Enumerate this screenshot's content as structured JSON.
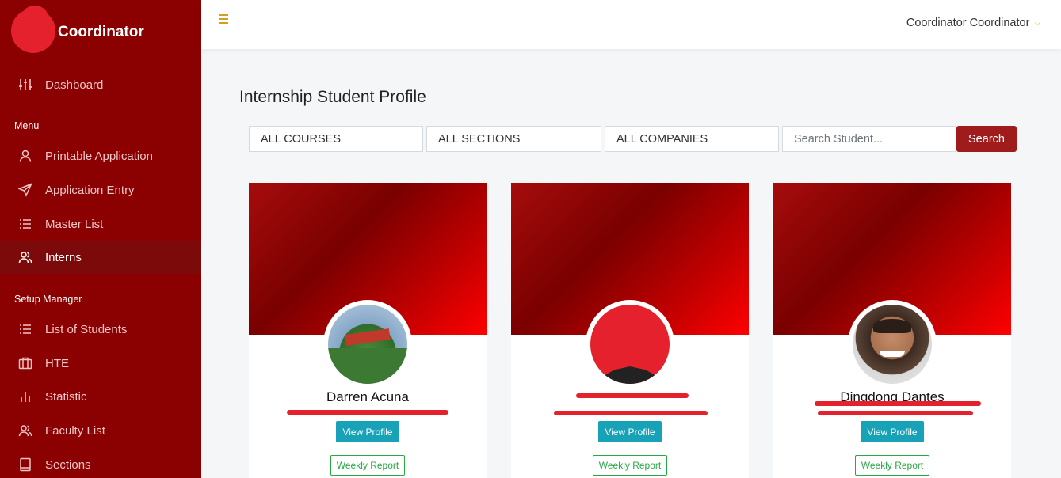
{
  "brand": {
    "title": "Coordinator"
  },
  "topbar": {
    "user_name": "Coordinator Coordinator"
  },
  "sidebar": {
    "dashboard": "Dashboard",
    "menu_title": "Menu",
    "menu_items": [
      "Printable Application",
      "Application Entry",
      "Master List",
      "Interns"
    ],
    "active_item": "Interns",
    "setup_title": "Setup Manager",
    "setup_items": [
      "List of Students",
      "HTE",
      "Statistic",
      "Faculty List",
      "Sections"
    ]
  },
  "main": {
    "title": "Internship Student Profile",
    "filters": {
      "courses": "ALL COURSES",
      "sections": "ALL SECTIONS",
      "companies": "ALL COMPANIES"
    },
    "search": {
      "placeholder": "Search Student...",
      "button": "Search"
    }
  },
  "cards": [
    {
      "name": "Darren Acuna",
      "email": "",
      "view_label": "View Profile",
      "weekly_label": "Weekly Report"
    },
    {
      "name": "",
      "email": "",
      "view_label": "View Profile",
      "weekly_label": "Weekly Report"
    },
    {
      "name": "Dingdong Dantes",
      "email": "",
      "view_label": "View Profile",
      "weekly_label": "Weekly Report"
    }
  ],
  "colors": {
    "sidebar": "#8b0000",
    "accent": "#a01c1c",
    "info": "#17a2b8",
    "success": "#28a745"
  }
}
